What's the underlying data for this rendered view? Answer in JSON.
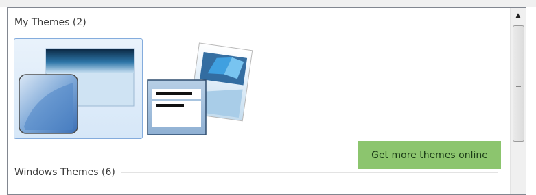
{
  "groups": [
    {
      "title": "My Themes (2)"
    },
    {
      "title": "Windows Themes (6)"
    }
  ],
  "themes": [
    {
      "name": "custom-theme-1",
      "selected": true
    },
    {
      "name": "custom-theme-2",
      "selected": false
    }
  ],
  "actions": {
    "get_more_label": "Get more themes online"
  },
  "colors": {
    "accent_green": "#8cc56e",
    "selection_border": "#84acdd",
    "selection_fill": "#d6e7f8",
    "glass_blue": "#1f5e97"
  },
  "scrollbar": {
    "up_icon": "up-arrow-icon"
  }
}
